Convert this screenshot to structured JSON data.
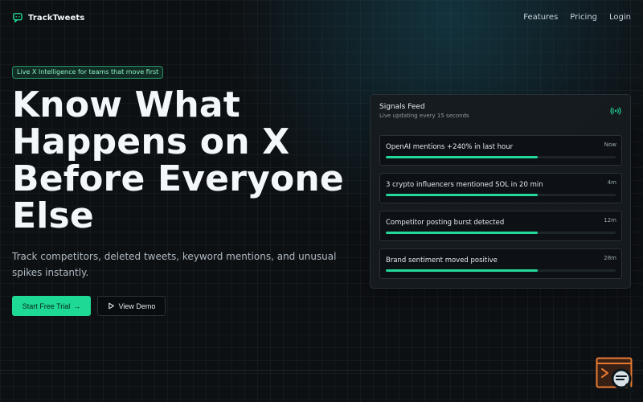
{
  "brand": {
    "name": "TrackTweets",
    "icon": "chat-bubble-icon"
  },
  "nav": {
    "links": [
      "Features",
      "Pricing",
      "Login"
    ]
  },
  "hero": {
    "badge": "Live X Intelligence for teams that move first",
    "title_lines": [
      "Know What",
      "Happens on X",
      "Before Everyone",
      "Else"
    ],
    "subtitle": "Track competitors, deleted tweets, keyword mentions, and unusual spikes instantly.",
    "primary_cta": "Start Free Trial",
    "secondary_cta": "View Demo"
  },
  "feed": {
    "title": "Signals Feed",
    "subtitle": "Live updating every 15 seconds",
    "live_icon": "broadcast-icon",
    "items": [
      {
        "text": "OpenAI mentions +240% in last hour",
        "time": "Now",
        "progress": 0.66
      },
      {
        "text": "3 crypto influencers mentioned SOL in 20 min",
        "time": "4m",
        "progress": 0.66
      },
      {
        "text": "Competitor posting burst detected",
        "time": "12m",
        "progress": 0.66
      },
      {
        "text": "Brand sentiment moved positive",
        "time": "28m",
        "progress": 0.66
      }
    ]
  },
  "colors": {
    "accent": "#1ed895",
    "background": "#0d1013",
    "card": "#161b1f",
    "muted_text": "#aeb9c1"
  },
  "icons": {
    "primary_cta": "arrow-right-icon",
    "secondary_cta": "play-icon",
    "corner_widget": "code-search-widget-icon"
  }
}
